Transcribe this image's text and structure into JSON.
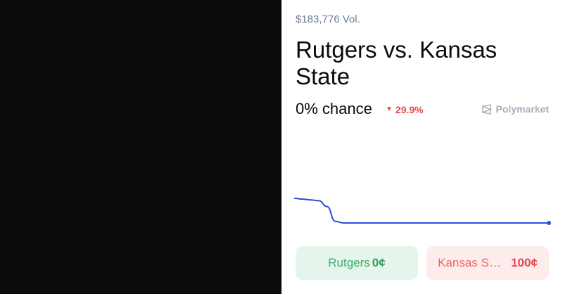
{
  "market": {
    "volume": "$183,776 Vol.",
    "title": "Rutgers vs. Kansas State",
    "chance": "0% chance",
    "change": "29.9%",
    "change_direction": "down",
    "brand": "Polymarket"
  },
  "colors": {
    "accent_line": "#2d4ed8",
    "down": "#e5484d",
    "yes_bg": "#e6f5ec",
    "yes_text": "#3aab6b",
    "no_bg": "#fdecec",
    "no_text": "#e86b5f"
  },
  "icons": {
    "change": "down-triangle-icon",
    "brand": "polymarket-logo-icon"
  },
  "chart_data": {
    "type": "line",
    "title": "",
    "xlabel": "",
    "ylabel": "",
    "ylim": [
      0,
      100
    ],
    "series": [
      {
        "values": [
          30,
          29,
          28,
          27,
          20,
          2,
          0,
          0,
          0,
          0,
          0,
          0,
          0,
          0,
          0,
          0,
          0,
          0,
          0,
          0,
          0,
          0,
          0,
          0,
          0,
          0,
          0,
          0,
          0,
          0,
          0,
          0
        ]
      }
    ]
  },
  "outcomes": [
    {
      "label": "Rutgers",
      "price": "0¢"
    },
    {
      "label": "Kansas State",
      "price": "100¢"
    }
  ]
}
